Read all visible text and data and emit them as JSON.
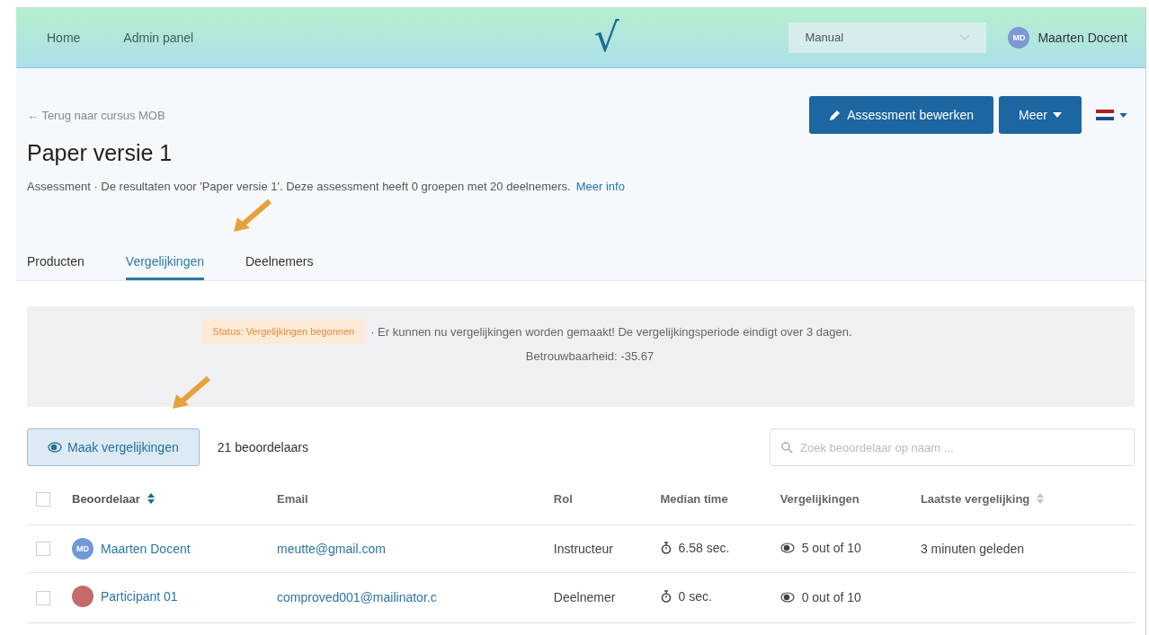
{
  "nav": {
    "links": [
      "Home",
      "Admin panel"
    ],
    "logo": "√",
    "mode_select": {
      "value": "Manual"
    },
    "user": {
      "initials": "MD",
      "name": "Maarten Docent"
    }
  },
  "header": {
    "back_link": "← Terug naar cursus MOB",
    "title": "Paper versie 1",
    "description": "Assessment · De resultaten voor 'Paper versie 1'. Deze assessment heeft 0 groepen met 20 deelnemers.",
    "more_link": "Meer info",
    "buttons": {
      "edit": "Assessment bewerken",
      "more": "Meer"
    }
  },
  "tabs": [
    {
      "label": "Producten",
      "selected": false
    },
    {
      "label": "Vergelijkingen",
      "selected": true
    },
    {
      "label": "Deelnemers",
      "selected": false
    }
  ],
  "status": {
    "badge": "Status: Vergelijkingen begonnen",
    "message": "· Er kunnen nu vergelijkingen worden gemaakt! De vergelijkingsperiode eindigt over 3 dagen.",
    "reliability": "Betrouwbaarheid: -35.67"
  },
  "toolbar": {
    "button": "Maak vergelijkingen",
    "count": "21 beoordelaars",
    "search": {
      "placeholder": "Zoek beoordelaar op naam ..."
    }
  },
  "table": {
    "columns": [
      {
        "label": "Beoordelaar",
        "sortable": true,
        "sorted": true
      },
      {
        "label": "Email",
        "sortable": false,
        "sorted": false
      },
      {
        "label": "Rol",
        "sortable": false,
        "sorted": false
      },
      {
        "label": "Median time",
        "sortable": false,
        "sorted": false
      },
      {
        "label": "Vergelijkingen",
        "sortable": false,
        "sorted": false
      },
      {
        "label": "Laatste vergelijking",
        "sortable": true,
        "sorted": false
      }
    ],
    "header_checked": false,
    "rows": [
      {
        "checked": false,
        "initials": "MD",
        "color": "#6f9ad8",
        "name": "Maarten Docent",
        "email": "meutte@gmail.com",
        "role": "Instructeur",
        "time": "6.58 sec.",
        "comparisons": "5 out of 10",
        "last": "3 minuten geleden"
      },
      {
        "checked": false,
        "color": "#c46a6a",
        "name": "Participant 01",
        "email": "comproved001@mailinator.c",
        "role": "Deelnemer",
        "time": "0 sec.",
        "comparisons": "0 out of 10"
      }
    ]
  }
}
